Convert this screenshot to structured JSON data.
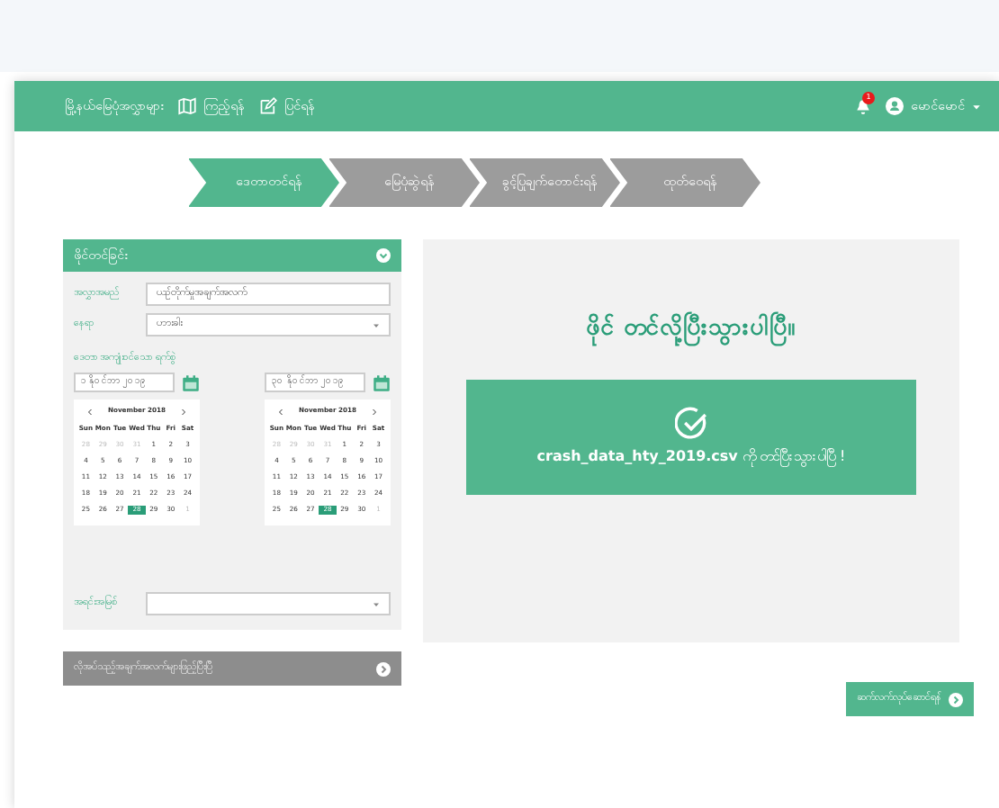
{
  "navbar": {
    "title": "မြို့နယ်မြေပုံအလွှာများ",
    "links": [
      {
        "kind": "map",
        "label": "ကြည့်ရန်"
      },
      {
        "kind": "edit",
        "label": "ပြင်ရန်"
      }
    ],
    "notification_count": "1",
    "user": "မောင်မောင်"
  },
  "steps": [
    {
      "label": "ဒေတာတင်ရန်",
      "selected": true
    },
    {
      "label": "မြေပုံဆွဲရန်",
      "selected": false
    },
    {
      "label": "ခွင့်ပြုချက်တောင်းရန်",
      "selected": false
    },
    {
      "label": "ထုတ်ဝေရန်",
      "selected": false
    }
  ],
  "left_panel": {
    "title": "ဖိုင်တင်ခြင်း",
    "fields": [
      {
        "kind": "input",
        "label": "အလွှာအမည်",
        "value": "ယဉ်တိုက်မှုအချက်အလက်"
      },
      {
        "kind": "select",
        "label": "နေရာ",
        "value": "ဟားခါး"
      }
    ],
    "date_label": "ဒေတာ အကျုံးဝင်သော ရက်စွဲ",
    "dates": [
      {
        "value": "၁ နိုဝင်ဘာ ၂၀၁၉",
        "month": "November 2018",
        "weekdays": [
          "Sun",
          "Mon",
          "Tue",
          "Wed",
          "Thu",
          "Fri",
          "Sat"
        ],
        "days": [
          {
            "d": "28",
            "muted": true,
            "selected": false
          },
          {
            "d": "29",
            "muted": true,
            "selected": false
          },
          {
            "d": "30",
            "muted": true,
            "selected": false
          },
          {
            "d": "31",
            "muted": true,
            "selected": false
          },
          {
            "d": "1",
            "muted": false,
            "selected": false
          },
          {
            "d": "2",
            "muted": false,
            "selected": false
          },
          {
            "d": "3",
            "muted": false,
            "selected": false
          },
          {
            "d": "4",
            "muted": false,
            "selected": false
          },
          {
            "d": "5",
            "muted": false,
            "selected": false
          },
          {
            "d": "6",
            "muted": false,
            "selected": false
          },
          {
            "d": "7",
            "muted": false,
            "selected": false
          },
          {
            "d": "8",
            "muted": false,
            "selected": false
          },
          {
            "d": "9",
            "muted": false,
            "selected": false
          },
          {
            "d": "10",
            "muted": false,
            "selected": false
          },
          {
            "d": "11",
            "muted": false,
            "selected": false
          },
          {
            "d": "12",
            "muted": false,
            "selected": false
          },
          {
            "d": "13",
            "muted": false,
            "selected": false
          },
          {
            "d": "14",
            "muted": false,
            "selected": false
          },
          {
            "d": "15",
            "muted": false,
            "selected": false
          },
          {
            "d": "16",
            "muted": false,
            "selected": false
          },
          {
            "d": "17",
            "muted": false,
            "selected": false
          },
          {
            "d": "18",
            "muted": false,
            "selected": false
          },
          {
            "d": "19",
            "muted": false,
            "selected": false
          },
          {
            "d": "20",
            "muted": false,
            "selected": false
          },
          {
            "d": "21",
            "muted": false,
            "selected": false
          },
          {
            "d": "22",
            "muted": false,
            "selected": false
          },
          {
            "d": "23",
            "muted": false,
            "selected": false
          },
          {
            "d": "24",
            "muted": false,
            "selected": false
          },
          {
            "d": "25",
            "muted": false,
            "selected": false
          },
          {
            "d": "26",
            "muted": false,
            "selected": false
          },
          {
            "d": "27",
            "muted": false,
            "selected": false
          },
          {
            "d": "28",
            "muted": false,
            "selected": true
          },
          {
            "d": "29",
            "muted": false,
            "selected": false
          },
          {
            "d": "30",
            "muted": false,
            "selected": false
          },
          {
            "d": "1",
            "muted": true,
            "selected": false
          }
        ]
      },
      {
        "value": "၃၀ နိုဝင်ဘာ ၂၀၁၉",
        "month": "November 2018",
        "weekdays": [
          "Sun",
          "Mon",
          "Tue",
          "Wed",
          "Thu",
          "Fri",
          "Sat"
        ],
        "days": [
          {
            "d": "28",
            "muted": true,
            "selected": false
          },
          {
            "d": "29",
            "muted": true,
            "selected": false
          },
          {
            "d": "30",
            "muted": true,
            "selected": false
          },
          {
            "d": "31",
            "muted": true,
            "selected": false
          },
          {
            "d": "1",
            "muted": false,
            "selected": false
          },
          {
            "d": "2",
            "muted": false,
            "selected": false
          },
          {
            "d": "3",
            "muted": false,
            "selected": false
          },
          {
            "d": "4",
            "muted": false,
            "selected": false
          },
          {
            "d": "5",
            "muted": false,
            "selected": false
          },
          {
            "d": "6",
            "muted": false,
            "selected": false
          },
          {
            "d": "7",
            "muted": false,
            "selected": false
          },
          {
            "d": "8",
            "muted": false,
            "selected": false
          },
          {
            "d": "9",
            "muted": false,
            "selected": false
          },
          {
            "d": "10",
            "muted": false,
            "selected": false
          },
          {
            "d": "11",
            "muted": false,
            "selected": false
          },
          {
            "d": "12",
            "muted": false,
            "selected": false
          },
          {
            "d": "13",
            "muted": false,
            "selected": false
          },
          {
            "d": "14",
            "muted": false,
            "selected": false
          },
          {
            "d": "15",
            "muted": false,
            "selected": false
          },
          {
            "d": "16",
            "muted": false,
            "selected": false
          },
          {
            "d": "17",
            "muted": false,
            "selected": false
          },
          {
            "d": "18",
            "muted": false,
            "selected": false
          },
          {
            "d": "19",
            "muted": false,
            "selected": false
          },
          {
            "d": "20",
            "muted": false,
            "selected": false
          },
          {
            "d": "21",
            "muted": false,
            "selected": false
          },
          {
            "d": "22",
            "muted": false,
            "selected": false
          },
          {
            "d": "23",
            "muted": false,
            "selected": false
          },
          {
            "d": "24",
            "muted": false,
            "selected": false
          },
          {
            "d": "25",
            "muted": false,
            "selected": false
          },
          {
            "d": "26",
            "muted": false,
            "selected": false
          },
          {
            "d": "27",
            "muted": false,
            "selected": false
          },
          {
            "d": "28",
            "muted": false,
            "selected": true
          },
          {
            "d": "29",
            "muted": false,
            "selected": false
          },
          {
            "d": "30",
            "muted": false,
            "selected": false
          },
          {
            "d": "1",
            "muted": true,
            "selected": false
          }
        ]
      }
    ],
    "source": {
      "label": "အရင်းအမြစ်"
    },
    "next_section": "လိုအပ်သည့်အချက်အလက်များဖြည့်ပြီးပြီ"
  },
  "result": {
    "heading": "ဖိုင် တင်လို့ပြီးသွားပါပြီ။",
    "file": "crash_data_hty_2019.csv",
    "message": "ကို တင်ပြီးသွားပါပြီ !"
  },
  "continue_button": "ဆက်လက်လုပ်ဆောင်ရန်"
}
